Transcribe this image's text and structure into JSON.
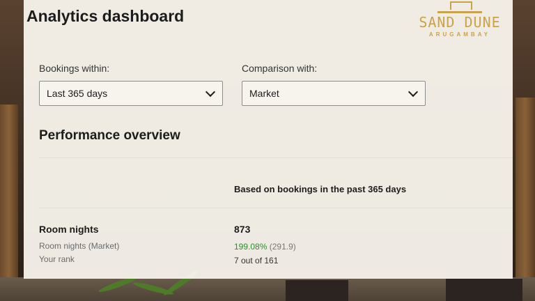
{
  "header": {
    "title": "Analytics dashboard"
  },
  "logo": {
    "name": "SAND DUNE",
    "subtitle": "ARUGAMBAY"
  },
  "filters": {
    "bookings_label": "Bookings within:",
    "bookings_value": "Last 365 days",
    "comparison_label": "Comparison with:",
    "comparison_value": "Market"
  },
  "overview": {
    "title": "Performance overview",
    "column_header": "Based on bookings in the past 365 days",
    "metric": {
      "label": "Room nights",
      "value": "873",
      "market_label": "Room nights (Market)",
      "market_pct": "199.08%",
      "market_value": "(291.9)",
      "rank_label": "Your rank",
      "rank_value": "7 out of 161"
    }
  },
  "colors": {
    "accent_gold": "#c9a24a",
    "positive_green": "#2e8b2e"
  }
}
